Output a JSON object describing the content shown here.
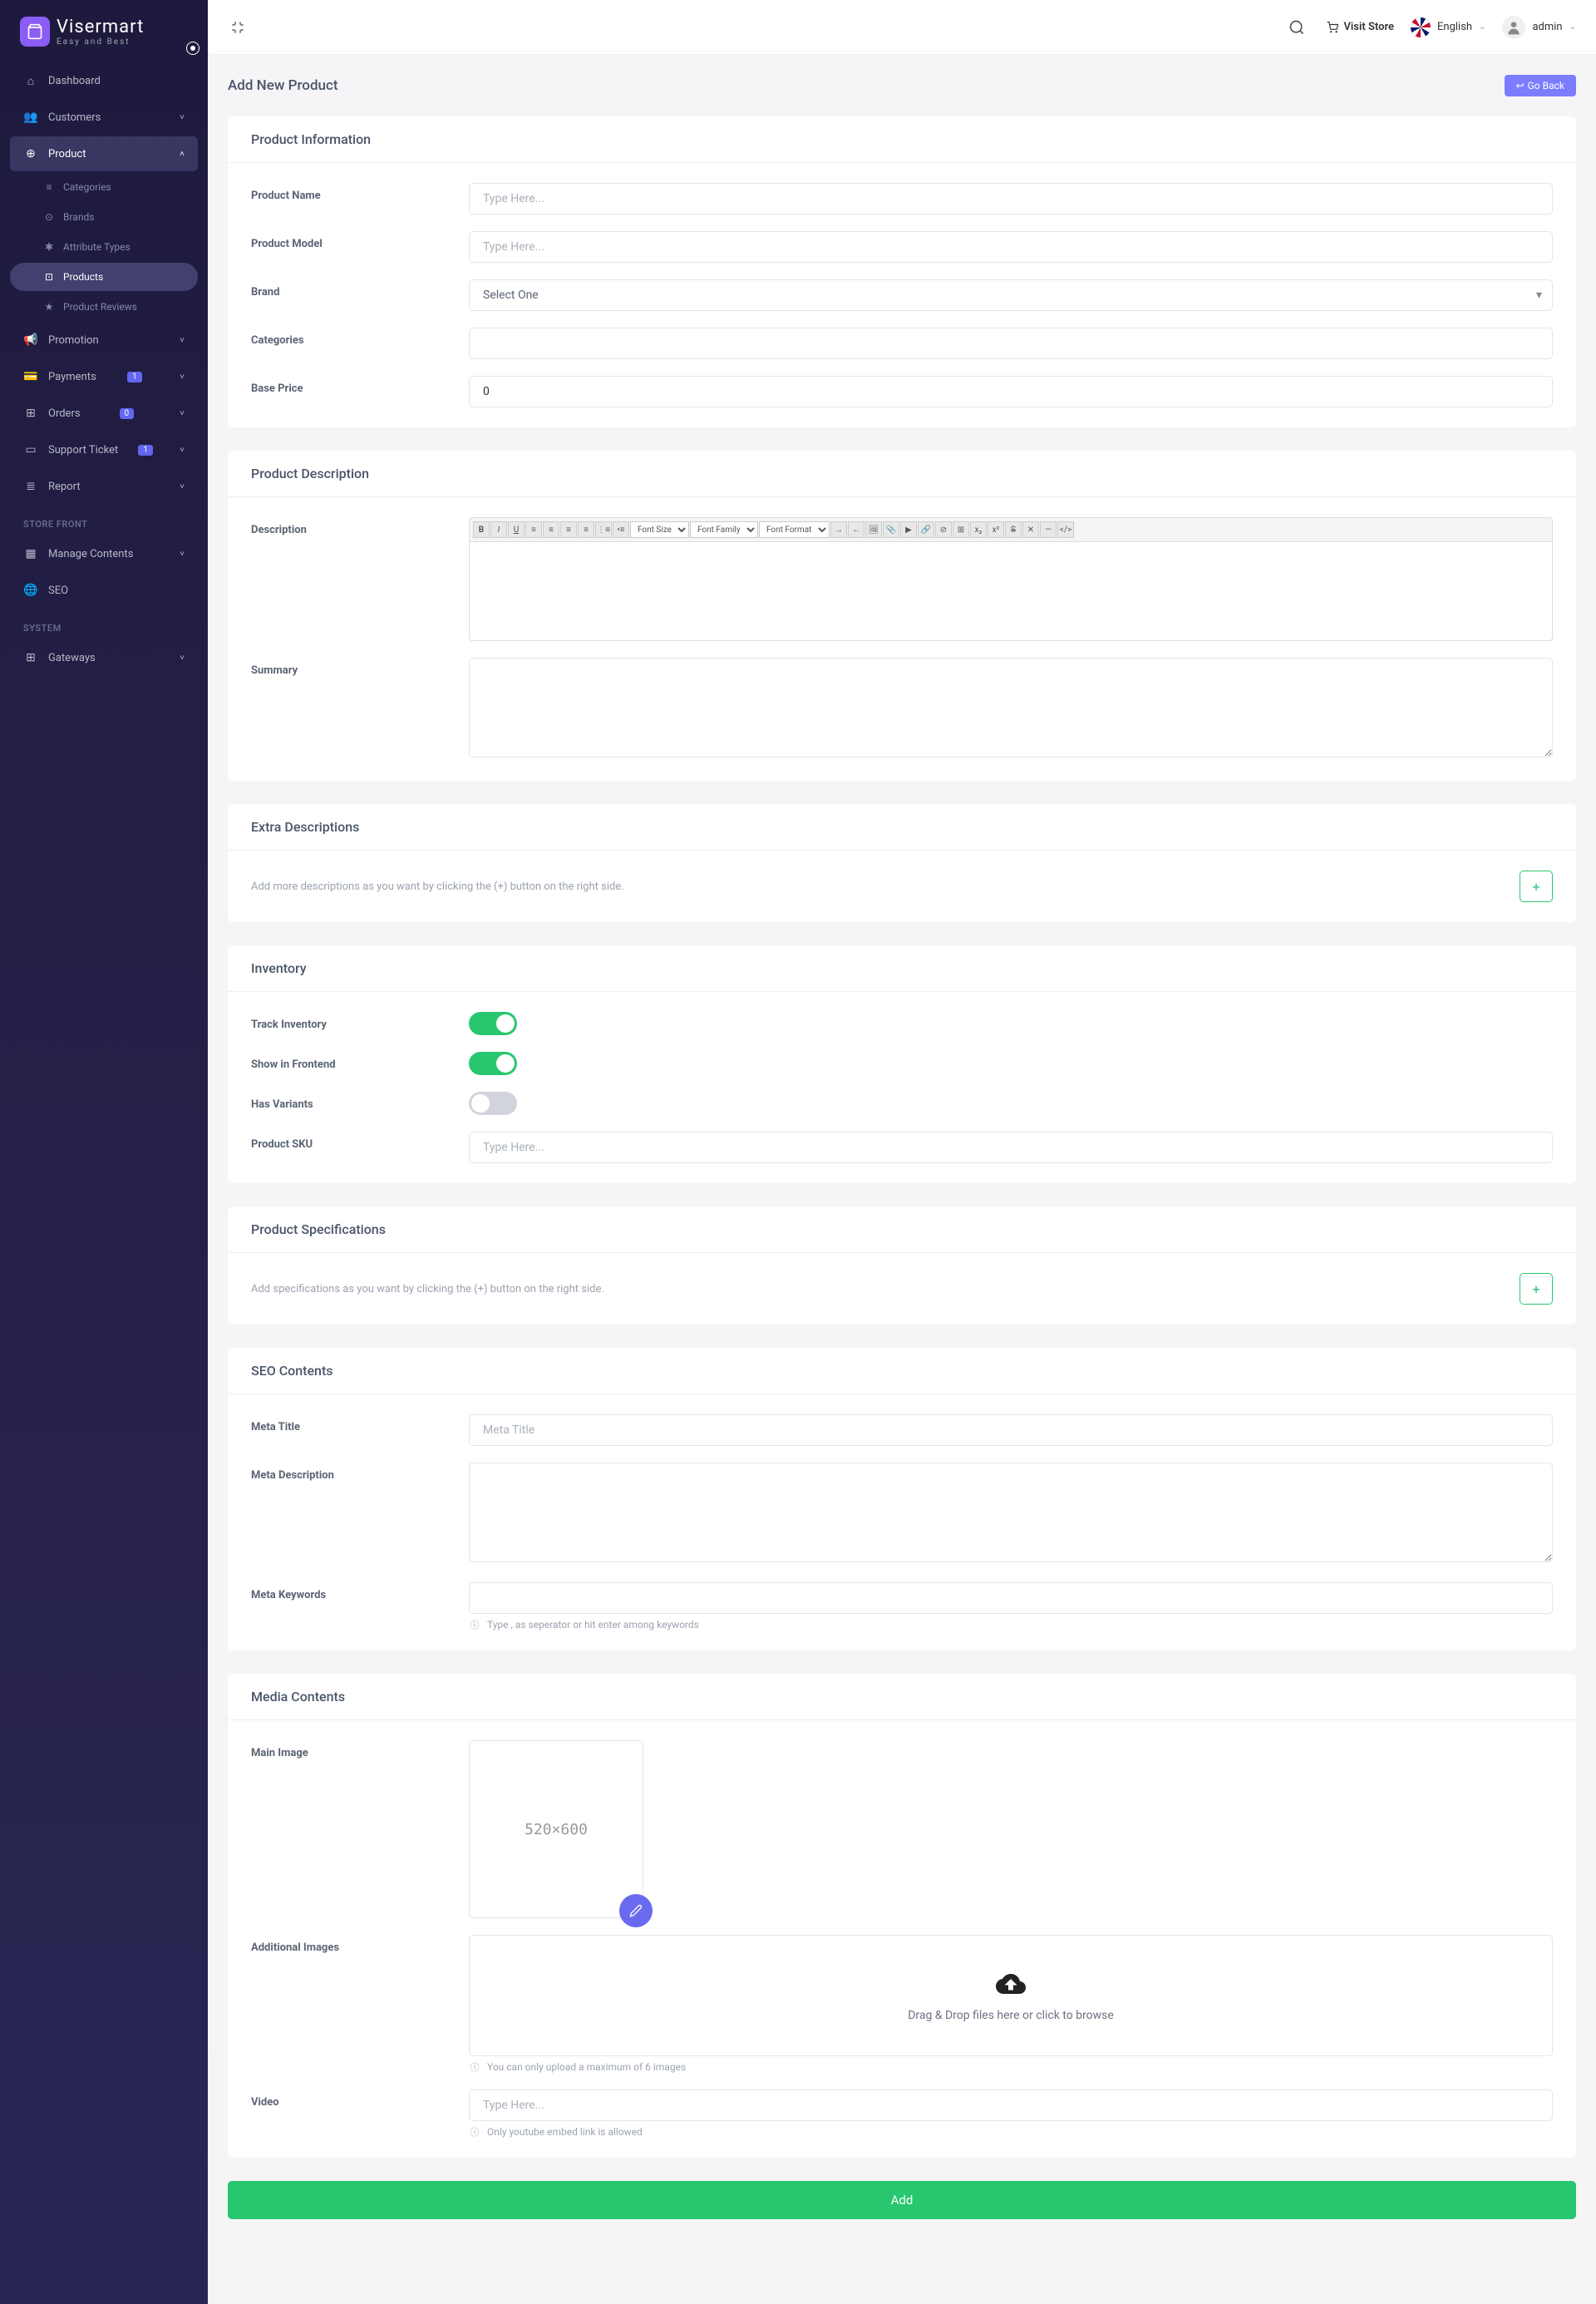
{
  "brand": {
    "name": "Visermart",
    "tagline": "Easy and Best"
  },
  "topbar": {
    "visit_store": "Visit Store",
    "language": "English",
    "user": "admin"
  },
  "sidebar": {
    "items": [
      {
        "icon": "⌂",
        "label": "Dashboard"
      },
      {
        "icon": "👥",
        "label": "Customers",
        "chevron": true
      },
      {
        "icon": "⊕",
        "label": "Product",
        "chevron": true,
        "expanded": true,
        "active": true,
        "sub": [
          {
            "icon": "≡",
            "label": "Categories"
          },
          {
            "icon": "⊙",
            "label": "Brands"
          },
          {
            "icon": "✱",
            "label": "Attribute Types"
          },
          {
            "icon": "⊡",
            "label": "Products",
            "active": true
          },
          {
            "icon": "★",
            "label": "Product Reviews"
          }
        ]
      },
      {
        "icon": "📢",
        "label": "Promotion",
        "chevron": true
      },
      {
        "icon": "💳",
        "label": "Payments",
        "badge": "1",
        "chevron": true
      },
      {
        "icon": "⊞",
        "label": "Orders",
        "badge": "0",
        "chevron": true
      },
      {
        "icon": "▭",
        "label": "Support Ticket",
        "badge": "1",
        "chevron": true
      },
      {
        "icon": "≣",
        "label": "Report",
        "chevron": true
      }
    ],
    "storefront_label": "STORE FRONT",
    "storefront": [
      {
        "icon": "▦",
        "label": "Manage Contents",
        "chevron": true
      },
      {
        "icon": "🌐",
        "label": "SEO"
      }
    ],
    "system_label": "SYSTEM",
    "system": [
      {
        "icon": "⊞",
        "label": "Gateways",
        "chevron": true
      }
    ]
  },
  "page": {
    "title": "Add New Product",
    "go_back": "Go Back"
  },
  "sections": {
    "product_info": {
      "title": "Product Information",
      "fields": {
        "name": {
          "label": "Product Name",
          "placeholder": "Type Here..."
        },
        "model": {
          "label": "Product Model",
          "placeholder": "Type Here..."
        },
        "brand": {
          "label": "Brand",
          "value": "Select One"
        },
        "categories": {
          "label": "Categories"
        },
        "base_price": {
          "label": "Base Price",
          "value": "0"
        }
      }
    },
    "description": {
      "title": "Product Description",
      "fields": {
        "description": {
          "label": "Description"
        },
        "summary": {
          "label": "Summary"
        }
      },
      "editor": {
        "font_size": "Font Size",
        "font_family": "Font Family",
        "font_format": "Font Format"
      }
    },
    "extra_desc": {
      "title": "Extra Descriptions",
      "hint": "Add more descriptions as you want by clicking the (+) button on the right side."
    },
    "inventory": {
      "title": "Inventory",
      "fields": {
        "track": {
          "label": "Track Inventory"
        },
        "show_frontend": {
          "label": "Show in Frontend"
        },
        "has_variants": {
          "label": "Has Variants"
        },
        "sku": {
          "label": "Product SKU",
          "placeholder": "Type Here..."
        }
      }
    },
    "specs": {
      "title": "Product Specifications",
      "hint": "Add specifications as you want by clicking the (+) button on the right side."
    },
    "seo": {
      "title": "SEO Contents",
      "fields": {
        "meta_title": {
          "label": "Meta Title",
          "placeholder": "Meta Title"
        },
        "meta_desc": {
          "label": "Meta Description"
        },
        "meta_keywords": {
          "label": "Meta Keywords",
          "help": "Type , as seperator or hit enter among keywords"
        }
      }
    },
    "media": {
      "title": "Media Contents",
      "fields": {
        "main_image": {
          "label": "Main Image",
          "placeholder": "520×600"
        },
        "additional": {
          "label": "Additional Images",
          "dropzone": "Drag & Drop files here or click to browse",
          "help": "You can only upload a maximum of 6 images"
        },
        "video": {
          "label": "Video",
          "placeholder": "Type Here...",
          "help": "Only youtube embed link is allowed"
        }
      }
    }
  },
  "submit": "Add"
}
